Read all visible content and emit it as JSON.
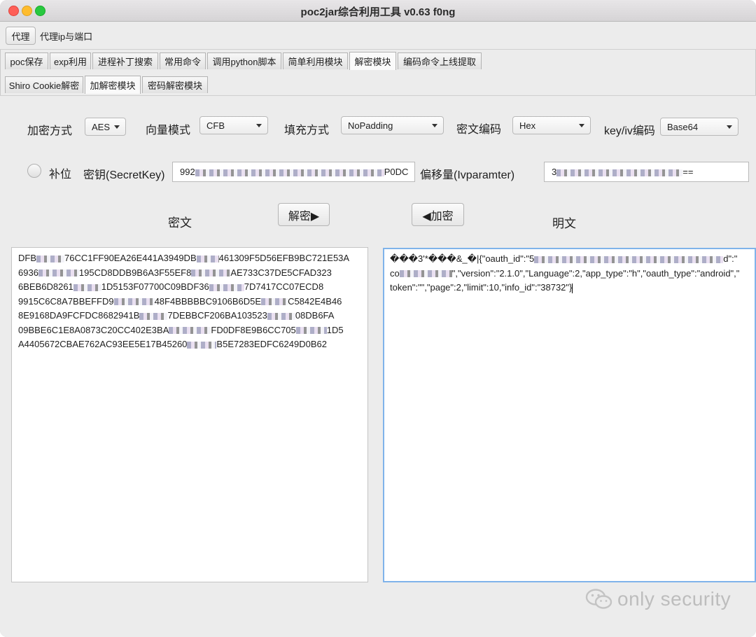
{
  "window": {
    "title": "poc2jar综合利用工具 v0.63  f0ng"
  },
  "proxy": {
    "button_label": "代理",
    "label": "代理ip与端口"
  },
  "tabs_main": [
    {
      "label": "poc保存"
    },
    {
      "label": "exp利用"
    },
    {
      "label": "进程补丁搜索"
    },
    {
      "label": "常用命令"
    },
    {
      "label": "调用python脚本"
    },
    {
      "label": "简单利用模块"
    },
    {
      "label": "解密模块"
    },
    {
      "label": "编码命令上线提取"
    }
  ],
  "tabs_sub": [
    {
      "label": "Shiro Cookie解密"
    },
    {
      "label": "加解密模块"
    },
    {
      "label": "密码解密模块"
    }
  ],
  "settings": {
    "encrypt_label": "加密方式",
    "encrypt_value": "AES",
    "vector_label": "向量模式",
    "vector_value": "CFB",
    "padding_label": "填充方式",
    "padding_value": "NoPadding",
    "cipher_enc_label": "密文编码",
    "cipher_enc_value": "Hex",
    "keyiv_label": "key/iv编码",
    "keyiv_value": "Base64"
  },
  "key_row": {
    "pad_label": "补位",
    "secret_label": "密钥(SecretKey)",
    "secret_prefix": "992",
    "secret_suffix": "P0DC",
    "iv_label": "偏移量(Ivparamter)",
    "iv_prefix": "3",
    "iv_suffix": "=="
  },
  "actions": {
    "decrypt": "解密▶",
    "encrypt": "◀加密"
  },
  "cipher": {
    "title": "密文",
    "lines": [
      {
        "a": "DFB",
        "b": "76CC1FF90EA26E441A3949DB",
        "c": "461309F5D56EFB9BC721E53A"
      },
      {
        "a": "6936",
        "b": "195CD8DDB9B6A3F55EF8",
        "c": "AE733C37DE5CFAD323"
      },
      {
        "a": "6BEB6D8261",
        "b": "1D5153F07700C09BDF36",
        "c": "7D7417CC07ECD8"
      },
      {
        "a": "9915C6C8A7BBEFFD9",
        "b": "48F4BBBBBC9106B6D5E",
        "c": "C5842E4B46"
      },
      {
        "a": "8E9168DA9FCFDC8682941B",
        "b": "7DEBBCF206BA103523",
        "c": "08DB6FA"
      },
      {
        "a": "09BBE6C1E8A0873C20CC402E3BA",
        "b": "FD0DF8E9B6CC705",
        "c": "1D5"
      },
      {
        "a": "A4405672CBAE762AC93EE5E17B45260",
        "b": "B5E7283EDFC6249D0",
        "c": "B62"
      }
    ]
  },
  "plain": {
    "title": "明文",
    "line1_a": "���3'*���&_�|{\"oauth_id\":\"5",
    "line1_b": "d\":\"",
    "line2_a": "co",
    "line2_b": "\",\"version\":\"2.1.0\",\"Language\":2,\"app_type\":\"h\",\"oauth_type\":\"android\",\"",
    "line3": "token\":\"\",\"page\":2,\"limit\":10,\"info_id\":\"38732\"}"
  },
  "watermark": {
    "text": "only security"
  }
}
